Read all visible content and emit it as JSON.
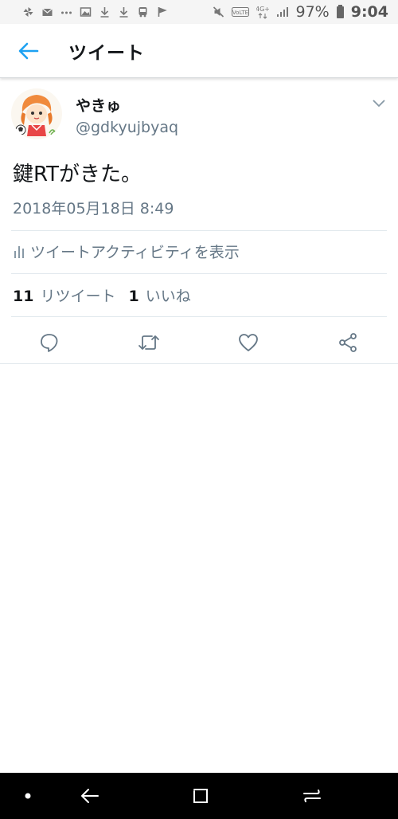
{
  "status_bar": {
    "battery_pct": "97%",
    "time": "9:04",
    "icons": [
      "pinwheel-icon",
      "mail-icon",
      "dots-icon",
      "image-icon",
      "download-icon",
      "download-icon",
      "bus-icon",
      "flag-icon",
      "mute-icon",
      "volte-icon",
      "4g-icon",
      "signal-icon",
      "battery-icon"
    ]
  },
  "header": {
    "title": "ツイート"
  },
  "tweet": {
    "display_name": "やきゅ",
    "handle": "@gdkyujbyaq",
    "text": "鍵RTがきた。",
    "timestamp": "2018年05月18日 8:49",
    "activity_label": "ツイートアクティビティを表示",
    "retweet_count": "11",
    "retweet_label": "リツイート",
    "like_count": "1",
    "like_label": "いいね"
  },
  "colors": {
    "accent": "#1da1f2",
    "muted": "#657786",
    "text": "#14171a",
    "divider": "#e1e8ed"
  }
}
